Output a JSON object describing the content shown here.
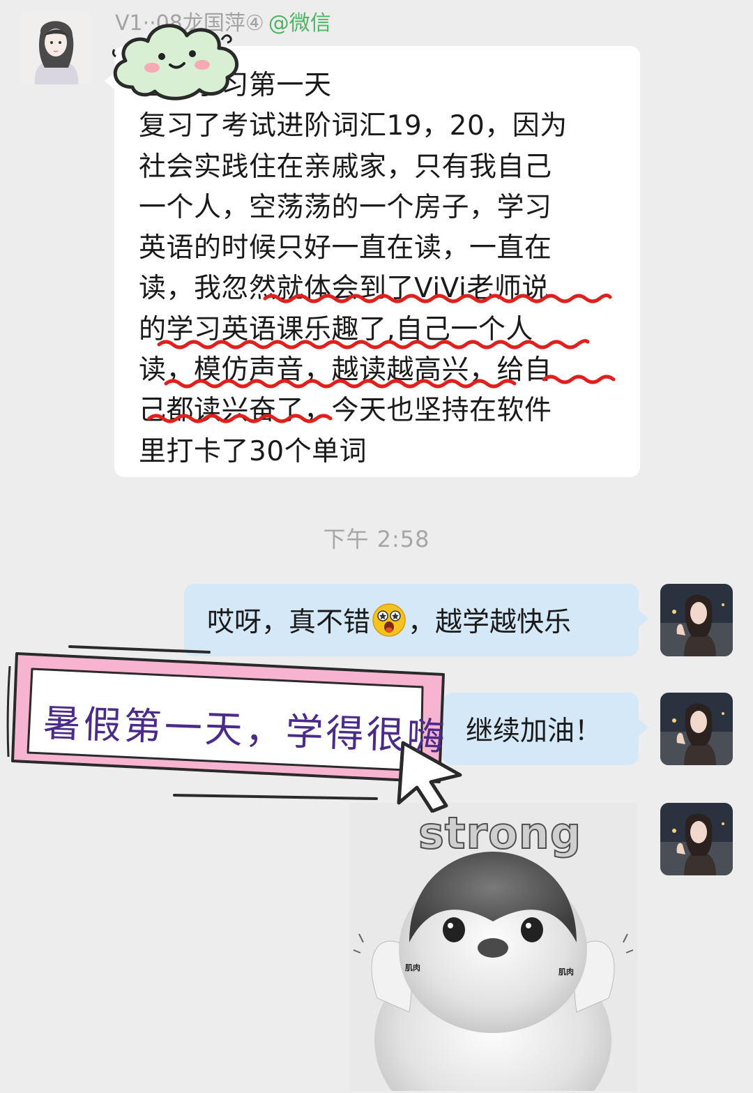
{
  "incoming": {
    "sender_name": "V1··08龙国萍④",
    "source_label": "@微信",
    "lines": [
      "暑假学习第一天",
      "复习了考试进阶词汇19，20，因为",
      "社会实践住在亲戚家，只有我自己",
      "一个人，空荡荡的一个房子，学习",
      "英语的时候只好一直在读，一直在",
      "读，我忽然就体会到了ViVi老师说",
      "的学习英语课乐趣了,自己一个人",
      "读，模仿声音，越读越高兴，给自",
      "己都读兴奋了，今天也坚持在软件",
      "里打卡了30个单词"
    ],
    "annotation_color": "#e0201c"
  },
  "time_divider": "下午 2:58",
  "outgoing": {
    "message_1_before": "哎呀，真不错",
    "message_1_emoji": "star-struck-emoji",
    "message_1_after": "，越学越快乐",
    "message_2": "继续加油！",
    "sticker": {
      "caption": "strong",
      "left_label": "肌肉",
      "right_label": "肌肉"
    },
    "bubble_color": "#d5e8f7"
  },
  "overlay": {
    "banner_text": "暑假第一天，学得很嗨",
    "banner_border_color": "#f3a6c8",
    "banner_text_color": "#4a2b8a"
  }
}
